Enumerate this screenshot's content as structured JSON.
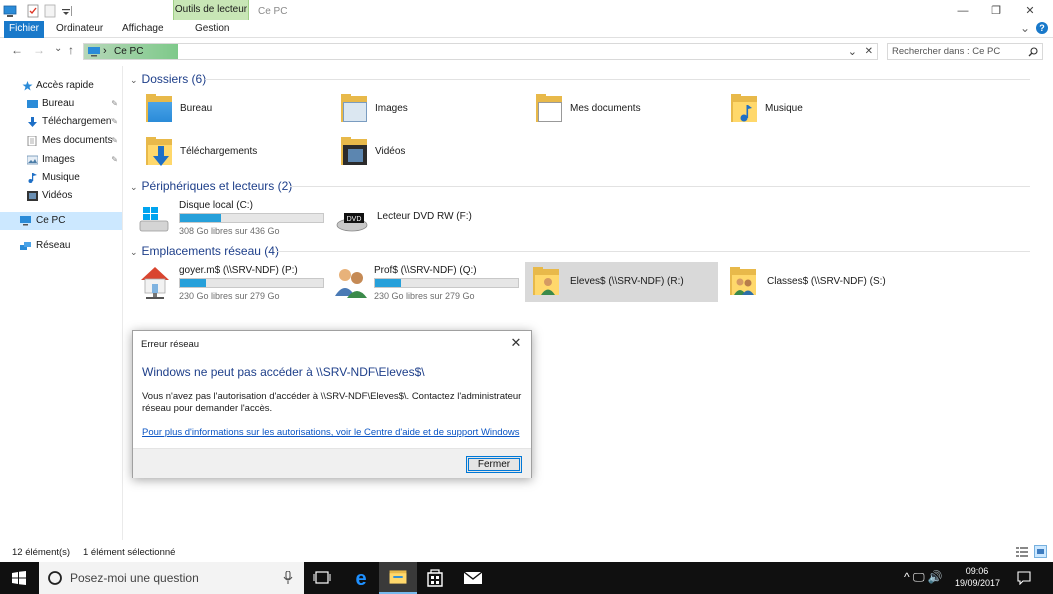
{
  "window": {
    "title": "Ce PC",
    "context_tab": "Outils de lecteur",
    "minimize_glyph": "—",
    "maximize_glyph": "❐",
    "close_glyph": "✕"
  },
  "ribbon": {
    "tabs": [
      "Fichier",
      "Ordinateur",
      "Affichage",
      "Gestion"
    ],
    "collapse_glyph": "⌄",
    "help_glyph": "?"
  },
  "address": {
    "separator": "›",
    "path": "Ce PC",
    "dropdown_glyph": "⌄",
    "clear_glyph": "✕",
    "search_placeholder": "Rechercher dans : Ce PC"
  },
  "nav": {
    "back": "←",
    "forward": "→",
    "recent": "⌄",
    "up": "↑",
    "items": [
      {
        "label": "Accès rapide",
        "icon": "star-icon",
        "pinned": false
      },
      {
        "label": "Bureau",
        "icon": "desktop-icon",
        "pinned": true
      },
      {
        "label": "Téléchargements",
        "icon": "download-icon",
        "pinned": true
      },
      {
        "label": "Mes documents",
        "icon": "document-icon",
        "pinned": true
      },
      {
        "label": "Images",
        "icon": "image-icon",
        "pinned": true
      },
      {
        "label": "Musique",
        "icon": "music-icon",
        "pinned": false
      },
      {
        "label": "Vidéos",
        "icon": "video-icon",
        "pinned": false
      },
      {
        "label": "Ce PC",
        "icon": "computer-icon",
        "pinned": false
      },
      {
        "label": "Réseau",
        "icon": "network-icon",
        "pinned": false
      }
    ],
    "pin_glyph": "✎"
  },
  "groups": {
    "folders": "Dossiers (6)",
    "devices": "Périphériques et lecteurs (2)",
    "network": "Emplacements réseau (4)",
    "chevron": "⌄"
  },
  "folders": [
    {
      "label": "Bureau",
      "icon": "desktop-folder-icon"
    },
    {
      "label": "Images",
      "icon": "images-folder-icon"
    },
    {
      "label": "Mes documents",
      "icon": "documents-folder-icon"
    },
    {
      "label": "Musique",
      "icon": "music-folder-icon"
    },
    {
      "label": "Téléchargements",
      "icon": "downloads-folder-icon"
    },
    {
      "label": "Vidéos",
      "icon": "videos-folder-icon"
    }
  ],
  "drives": [
    {
      "name": "Disque local (C:)",
      "free": "308 Go libres sur 436 Go",
      "used_fraction": 0.29,
      "icon": "local-disk-icon"
    },
    {
      "name": "Lecteur DVD RW (F:)",
      "icon": "dvd-drive-icon",
      "dvd_label": "DVD"
    }
  ],
  "network": [
    {
      "name": "goyer.m$ (\\\\SRV-NDF) (P:)",
      "free": "230 Go libres sur 279 Go",
      "used_fraction": 0.18,
      "icon": "home-share-icon"
    },
    {
      "name": "Prof$ (\\\\SRV-NDF) (Q:)",
      "free": "230 Go libres sur 279 Go",
      "used_fraction": 0.18,
      "icon": "users-share-icon"
    },
    {
      "name": "Eleves$ (\\\\SRV-NDF) (R:)",
      "icon": "users-folder-icon",
      "selected": true
    },
    {
      "name": "Classes$ (\\\\SRV-NDF) (S:)",
      "icon": "users-folder-icon"
    }
  ],
  "dialog": {
    "title": "Erreur réseau",
    "heading": "Windows ne peut pas accéder à \\\\SRV-NDF\\Eleves$\\",
    "message": "Vous n'avez pas l'autorisation d'accéder à \\\\SRV-NDF\\Eleves$\\. Contactez l'administrateur réseau pour demander l'accès.",
    "link": "Pour plus d'informations sur les autorisations, voir le Centre d'aide et de support Windows",
    "button": "Fermer",
    "close_glyph": "✕"
  },
  "status": {
    "count": "12 élément(s)",
    "selected": "1 élément sélectionné"
  },
  "taskbar": {
    "search_placeholder": "Posez-moi une question",
    "time": "09:06",
    "date": "19/09/2017",
    "tray_glyphs": "^ 🖵 🔊"
  },
  "colors": {
    "accent": "#1979ca",
    "context_tab": "#c8e6b6",
    "selection": "#cce8ff",
    "heading_blue": "#1e3f8a",
    "bar_fill": "#26a0da"
  }
}
